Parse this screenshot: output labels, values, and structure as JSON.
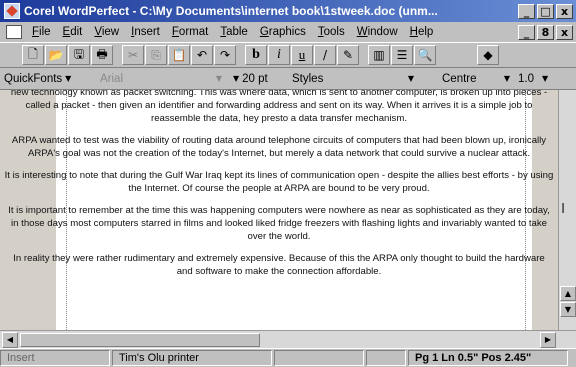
{
  "window": {
    "title": "Corel WordPerfect - C:\\My Documents\\internet book\\1stweek.doc (unm...",
    "min": "_",
    "max": "□",
    "close": "x",
    "doc_restore": "_",
    "doc_max": "8",
    "doc_close": "x"
  },
  "menu": {
    "items": [
      "File",
      "Edit",
      "View",
      "Insert",
      "Format",
      "Table",
      "Graphics",
      "Tools",
      "Window",
      "Help"
    ]
  },
  "toolbar": {
    "buttons": {
      "new": "🗋",
      "open": "📂",
      "save": "🖫",
      "print": "🖶",
      "cut": "✂",
      "copy": "⎘",
      "paste": "📋",
      "undo": "↶",
      "redo": "↷",
      "bold": "b",
      "italic": "i",
      "underline": "u",
      "line": "/",
      "draw": "✎",
      "columns": "▥",
      "bullets": "☰",
      "zoom": "🔍",
      "show": "◆"
    }
  },
  "propbar": {
    "quickfonts": "QuickFonts",
    "font": "Arial",
    "size": "20 pt",
    "styles": "Styles",
    "justify": "Centre",
    "spacing": "1.0"
  },
  "document": {
    "paragraphs": [
      "new technology known as packet switching. This was where data, which is sent to another computer, is broken up into pieces - called a packet - then given an identifier and forwarding address and sent on its way. When it arrives it is a simple job to reassemble the data, hey presto a data transfer mechanism.",
      "ARPA wanted to test was the viability of routing data around telephone circuits of computers that had been blown up, ironically ARPA's goal was not the creation of the today's Internet, but merely a data network that could survive a nuclear attack.",
      "It is interesting to note that during the Gulf War Iraq kept its lines of communication open - despite the allies best efforts - by using the Internet. Of course the people at ARPA are bound to be very proud.",
      "It is important to remember at the time this was happening computers were nowhere as near as sophisticated as they are today, in those days most computers starred in films and looked liked fridge freezers with flashing lights and invariably wanted to take over the world.",
      "In reality they were rather rudimentary and extremely expensive. Because of this the ARPA only thought to build the hardware and software to make the connection affordable."
    ]
  },
  "status": {
    "mode": "Insert",
    "printer": "Tim's Olu printer",
    "position": "Pg 1 Ln 0.5\" Pos 2.45\""
  }
}
